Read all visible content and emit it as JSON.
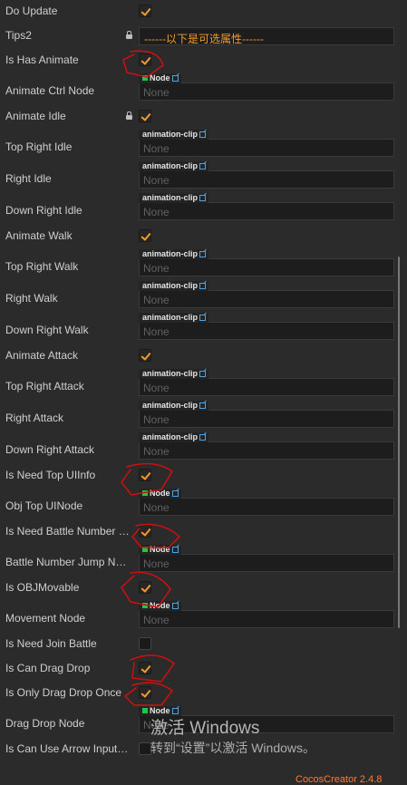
{
  "properties": [
    {
      "label": "Do Update",
      "type": "checkbox",
      "checked": true
    },
    {
      "label": "Tips2",
      "type": "tips",
      "value": "------以下是可选属性------",
      "locked": true
    },
    {
      "label": "Is Has Animate",
      "type": "checkbox",
      "checked": true
    },
    {
      "label": "Animate Ctrl Node",
      "type": "ref",
      "tag": "Node",
      "value": "None"
    },
    {
      "label": "Animate Idle",
      "type": "checkbox",
      "checked": true,
      "locked": true
    },
    {
      "label": "Top Right Idle",
      "type": "ref",
      "tag": "animation-clip",
      "value": "None"
    },
    {
      "label": "Right Idle",
      "type": "ref",
      "tag": "animation-clip",
      "value": "None"
    },
    {
      "label": "Down Right Idle",
      "type": "ref",
      "tag": "animation-clip",
      "value": "None"
    },
    {
      "label": "Animate Walk",
      "type": "checkbox",
      "checked": true
    },
    {
      "label": "Top Right Walk",
      "type": "ref",
      "tag": "animation-clip",
      "value": "None"
    },
    {
      "label": "Right Walk",
      "type": "ref",
      "tag": "animation-clip",
      "value": "None"
    },
    {
      "label": "Down Right Walk",
      "type": "ref",
      "tag": "animation-clip",
      "value": "None"
    },
    {
      "label": "Animate Attack",
      "type": "checkbox",
      "checked": true
    },
    {
      "label": "Top Right Attack",
      "type": "ref",
      "tag": "animation-clip",
      "value": "None"
    },
    {
      "label": "Right Attack",
      "type": "ref",
      "tag": "animation-clip",
      "value": "None"
    },
    {
      "label": "Down Right Attack",
      "type": "ref",
      "tag": "animation-clip",
      "value": "None"
    },
    {
      "label": "Is Need Top UIInfo",
      "type": "checkbox",
      "checked": true
    },
    {
      "label": "Obj Top UINode",
      "type": "ref",
      "tag": "Node",
      "value": "None"
    },
    {
      "label": "Is Need Battle Number Jump",
      "type": "checkbox",
      "checked": true
    },
    {
      "label": "Battle Number Jump Node",
      "type": "ref",
      "tag": "Node",
      "value": "None"
    },
    {
      "label": "Is OBJMovable",
      "type": "checkbox",
      "checked": true
    },
    {
      "label": "Movement Node",
      "type": "ref",
      "tag": "Node",
      "value": "None"
    },
    {
      "label": "Is Need Join Battle",
      "type": "checkbox",
      "checked": false
    },
    {
      "label": "Is Can Drag Drop",
      "type": "checkbox",
      "checked": true
    },
    {
      "label": "Is Only Drag Drop Once",
      "type": "checkbox",
      "checked": true
    },
    {
      "label": "Drag Drop Node",
      "type": "ref",
      "tag": "Node",
      "value": "None"
    },
    {
      "label": "Is Can Use Arrow Input Move",
      "type": "checkbox",
      "checked": false
    }
  ],
  "watermark": {
    "line1": "激活 Windows",
    "line2": "转到“设置”以激活 Windows。"
  },
  "footer": {
    "text": "CocosCreator 2.4.8"
  },
  "colors": {
    "background": "#2b2b2b",
    "checkmark": "#f39a2b",
    "annotation_red": "#d10f0f",
    "node_tag_square": "#19c94a",
    "link_icon": "#4aa3e8"
  }
}
